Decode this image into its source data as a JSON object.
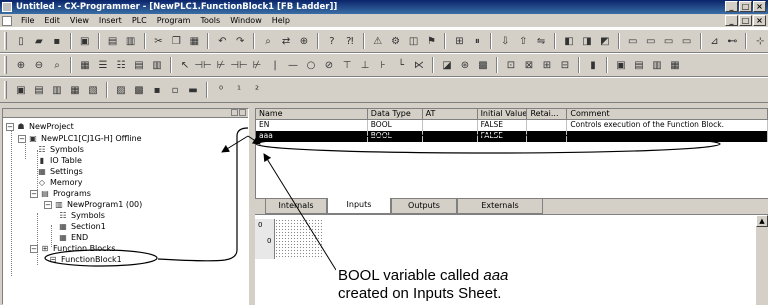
{
  "window": {
    "title": "Untitled - CX-Programmer - [NewPLC1.FunctionBlock1 [FB Ladder]]"
  },
  "menu": [
    "File",
    "Edit",
    "View",
    "Insert",
    "PLC",
    "Program",
    "Tools",
    "Window",
    "Help"
  ],
  "tree": {
    "items": [
      "NewProject",
      "NewPLC1[CJ1G-H] Offline",
      "Symbols",
      "IO Table",
      "Settings",
      "Memory",
      "Programs",
      "NewProgram1 (00)",
      "Symbols",
      "Section1",
      "END",
      "Function Blocks",
      "FunctionBlock1"
    ]
  },
  "variables": {
    "columns": [
      "Name",
      "Data Type",
      "AT",
      "Initial Value",
      "Retai...",
      "Comment"
    ],
    "rows": [
      [
        "EN",
        "BOOL",
        "",
        "FALSE",
        "",
        "Controls execution of the Function Block."
      ],
      [
        "aaa",
        "BOOL",
        "",
        "FALSE",
        "",
        ""
      ]
    ]
  },
  "tabs": [
    "Internals",
    "Inputs",
    "Outputs",
    "Externals"
  ],
  "active_tab": "Inputs",
  "ladder": {
    "rung": "0",
    "step": "0"
  },
  "annotation": {
    "line1_prefix": "BOOL variable called ",
    "line1_var": "aaa",
    "line2": "created on Inputs Sheet."
  }
}
